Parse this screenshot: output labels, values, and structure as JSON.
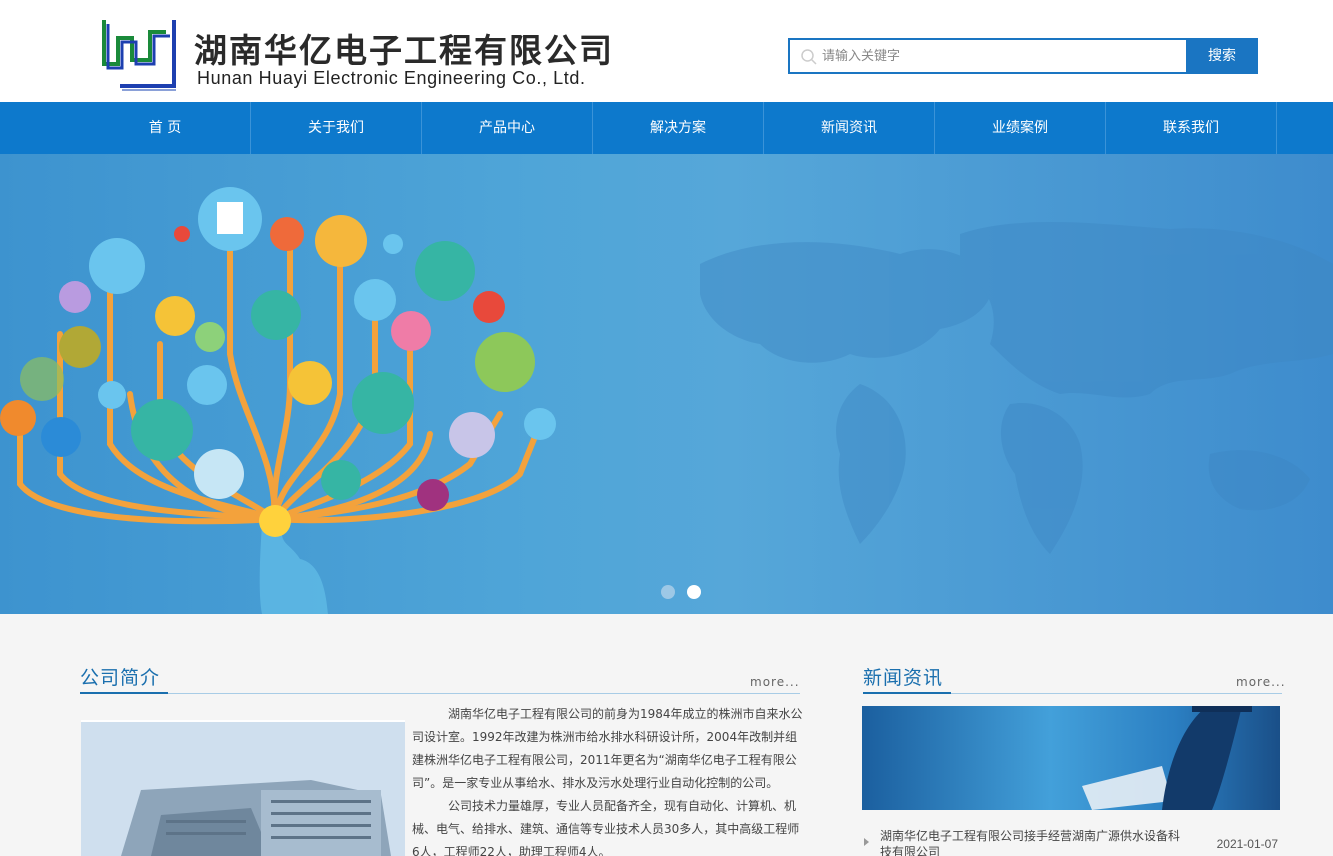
{
  "header": {
    "company_cn": "湖南华亿电子工程有限公司",
    "company_en": "Hunan Huayi Electronic Engineering Co., Ltd.",
    "search_placeholder": "请输入关键字",
    "search_button": "搜索"
  },
  "nav": {
    "items": [
      "首 页",
      "关于我们",
      "产品中心",
      "解决方案",
      "新闻资讯",
      "业绩案例",
      "联系我们"
    ]
  },
  "banner": {
    "slide_count": 2,
    "active_slide": 2
  },
  "about": {
    "title": "公司简介",
    "more": "more...",
    "paragraphs": [
      "湖南华亿电子工程有限公司的前身为1984年成立的株洲市自来水公司设计室。1992年改建为株洲市给水排水科研设计所，2004年改制并组建株洲华亿电子工程有限公司，2011年更名为“湖南华亿电子工程有限公司”。是一家专业从事给水、排水及污水处理行业自动化控制的公司。",
      "公司技术力量雄厚，专业人员配备齐全，现有自动化、计算机、机械、电气、给排水、建筑、通信等专业技术人员30多人，其中高级工程师6人，工程师22人，助理工程师4人。"
    ]
  },
  "news": {
    "title": "新闻资讯",
    "more": "more...",
    "items": [
      {
        "title": "湖南华亿电子工程有限公司接手经营湖南广源供水设备科技有限公司",
        "date": "2021-01-07"
      }
    ]
  },
  "colors": {
    "brand_blue": "#1a75c2",
    "nav_blue": "#0d79cc",
    "title_blue": "#1a6fae"
  }
}
